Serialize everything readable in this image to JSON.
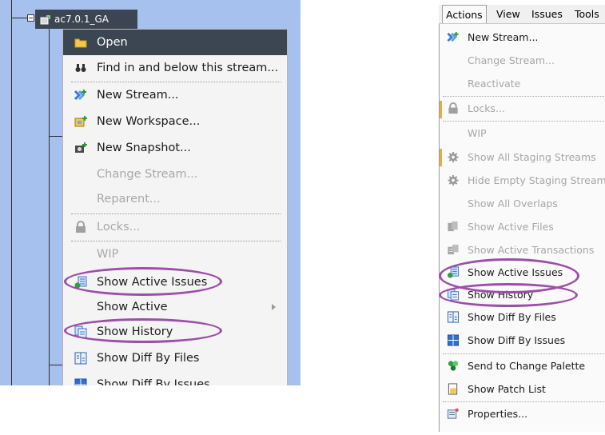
{
  "left": {
    "tree_node_label": "ac7.0.1_GA",
    "context_menu": {
      "items": [
        {
          "label": "Open",
          "state": "highlighted",
          "icon": "folder-icon"
        },
        {
          "label": "Find in and below this stream...",
          "state": "enabled",
          "icon": "binoculars-icon"
        },
        {
          "label": "New Stream...",
          "state": "enabled",
          "icon": "new-stream-icon"
        },
        {
          "label": "New Workspace...",
          "state": "enabled",
          "icon": "new-workspace-icon"
        },
        {
          "label": "New Snapshot...",
          "state": "enabled",
          "icon": "new-snapshot-icon"
        },
        {
          "label": "Change Stream...",
          "state": "disabled"
        },
        {
          "label": "Reparent...",
          "state": "disabled"
        },
        {
          "label": "Locks...",
          "state": "disabled",
          "icon": "lock-icon"
        },
        {
          "label": "WIP",
          "state": "disabled"
        },
        {
          "label": "Show Active Issues",
          "state": "enabled",
          "icon": "active-issues-icon",
          "circled": true
        },
        {
          "label": "Show Active",
          "state": "enabled",
          "submenu": true
        },
        {
          "label": "Show History",
          "state": "enabled",
          "icon": "history-icon",
          "circled": true
        },
        {
          "label": "Show Diff By Files",
          "state": "enabled",
          "icon": "diff-files-icon"
        },
        {
          "label": "Show Diff By Issues",
          "state": "enabled",
          "icon": "diff-issues-icon"
        }
      ]
    }
  },
  "right": {
    "menubar": [
      {
        "label": "Actions",
        "active": true
      },
      {
        "label": "View"
      },
      {
        "label": "Issues"
      },
      {
        "label": "Tools"
      }
    ],
    "dropdown": {
      "items": [
        {
          "label": "New Stream...",
          "state": "enabled",
          "icon": "new-stream-icon"
        },
        {
          "label": "Change Stream...",
          "state": "disabled"
        },
        {
          "label": "Reactivate",
          "state": "disabled"
        },
        {
          "label": "Locks...",
          "state": "disabled",
          "icon": "lock-icon"
        },
        {
          "label": "WIP",
          "state": "disabled"
        },
        {
          "label": "Show All Staging Streams",
          "state": "disabled",
          "icon": "gear-icon"
        },
        {
          "label": "Hide Empty Staging Streams",
          "state": "disabled",
          "icon": "gear-icon"
        },
        {
          "label": "Show All Overlaps",
          "state": "disabled"
        },
        {
          "label": "Show Active Files",
          "state": "disabled",
          "icon": "files-icon"
        },
        {
          "label": "Show Active Transactions",
          "state": "disabled",
          "icon": "transactions-icon"
        },
        {
          "label": "Show Active Issues",
          "state": "enabled",
          "icon": "active-issues-icon",
          "circled": true
        },
        {
          "label": "Show History",
          "state": "enabled",
          "icon": "history-icon",
          "circled": true
        },
        {
          "label": "Show Diff By Files",
          "state": "enabled",
          "icon": "diff-files-icon"
        },
        {
          "label": "Show Diff By Issues",
          "state": "enabled",
          "icon": "diff-issues-icon"
        },
        {
          "label": "Send to Change Palette",
          "state": "enabled",
          "icon": "change-palette-icon"
        },
        {
          "label": "Show Patch List",
          "state": "enabled",
          "icon": "patch-list-icon"
        },
        {
          "label": "Properties...",
          "state": "enabled",
          "icon": "properties-icon"
        }
      ]
    }
  },
  "colors": {
    "tree_background": "#a7c1ee",
    "highlight": "#3c4652",
    "annotation_ellipse": "#9b4fa7",
    "disabled_text": "#a8a8a8"
  }
}
